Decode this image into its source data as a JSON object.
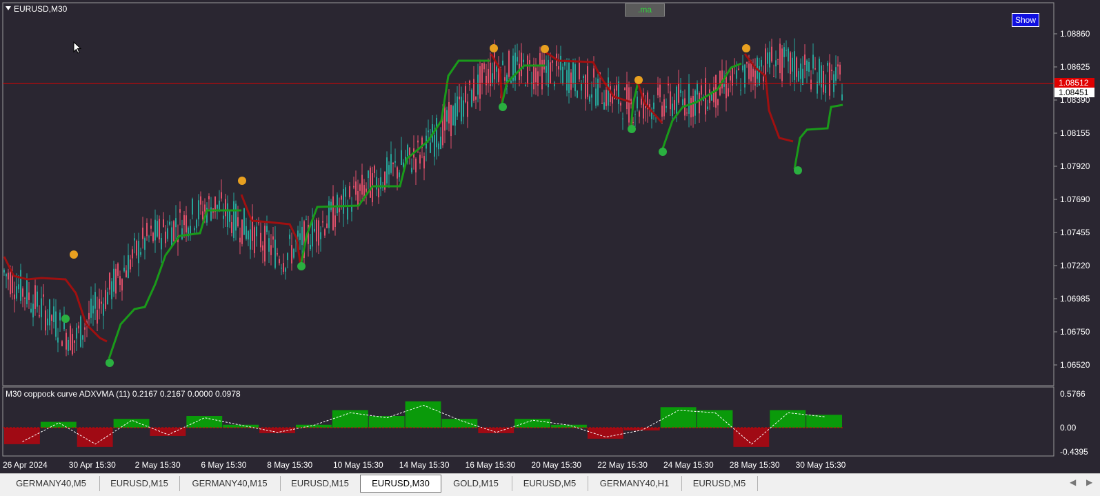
{
  "window": {
    "symbol": "EURUSD,M30"
  },
  "buttons": {
    "ma_label": ".ma",
    "show_label": "Show"
  },
  "price_axis": {
    "ticks": [
      "1.08860",
      "1.08625",
      "1.08390",
      "1.08155",
      "1.07920",
      "1.07690",
      "1.07455",
      "1.07220",
      "1.06985",
      "1.06750",
      "1.06520"
    ],
    "current_price": "1.08512",
    "second_price": "1.08451"
  },
  "indicator": {
    "title": "M30 coppock curve ADXVMA (11) 0.2167 0.2167 0.0000 0.0978",
    "ticks": [
      "0.5766",
      "0.00",
      "-0.4395"
    ]
  },
  "time_axis": [
    "26 Apr 2024",
    "30 Apr 15:30",
    "2 May 15:30",
    "6 May 15:30",
    "8 May 15:30",
    "10 May 15:30",
    "14 May 15:30",
    "16 May 15:30",
    "20 May 15:30",
    "22 May 15:30",
    "24 May 15:30",
    "28 May 15:30",
    "30 May 15:30"
  ],
  "tabs": [
    "GERMANY40,M5",
    "EURUSD,M15",
    "GERMANY40,M15",
    "EURUSD,M15",
    "EURUSD,M30",
    "GOLD,M15",
    "EURUSD,M5",
    "GERMANY40,H1",
    "EURUSD,M5"
  ],
  "active_tab_index": 4,
  "colors": {
    "background": "#2a2631",
    "bull_line": "#1a9a1a",
    "bear_line": "#a01010",
    "up_fill": "#0a9a0a",
    "down_fill": "#a00a14",
    "price_line": "#e00000"
  },
  "chart_data": [
    {
      "type": "line",
      "title": "EURUSD,M30",
      "ylim": [
        1.0645,
        1.0898
      ],
      "x": [
        "26 Apr 2024",
        "30 Apr 15:30",
        "2 May 15:30",
        "6 May 15:30",
        "8 May 15:30",
        "10 May 15:30",
        "14 May 15:30",
        "16 May 15:30",
        "20 May 15:30",
        "22 May 15:30",
        "24 May 15:30",
        "28 May 15:30",
        "30 May 15:30"
      ],
      "series": [
        {
          "values": [
            1.072,
            1.0675,
            1.074,
            1.0765,
            1.073,
            1.077,
            1.08,
            1.0855,
            1.0852,
            1.083,
            1.0835,
            1.086,
            1.0845
          ]
        }
      ],
      "price_line": 1.08512
    },
    {
      "type": "area",
      "title": "M30 coppock curve ADXVMA (11)",
      "ylim": [
        -0.4395,
        0.5766
      ],
      "values": [
        -0.3,
        0.1,
        -0.35,
        0.15,
        -0.15,
        0.2,
        0.05,
        -0.1,
        0.05,
        0.3,
        0.2,
        0.45,
        0.15,
        -0.1,
        0.15,
        0.05,
        -0.2,
        -0.05,
        0.35,
        0.3,
        -0.35,
        0.3,
        0.22
      ]
    }
  ]
}
